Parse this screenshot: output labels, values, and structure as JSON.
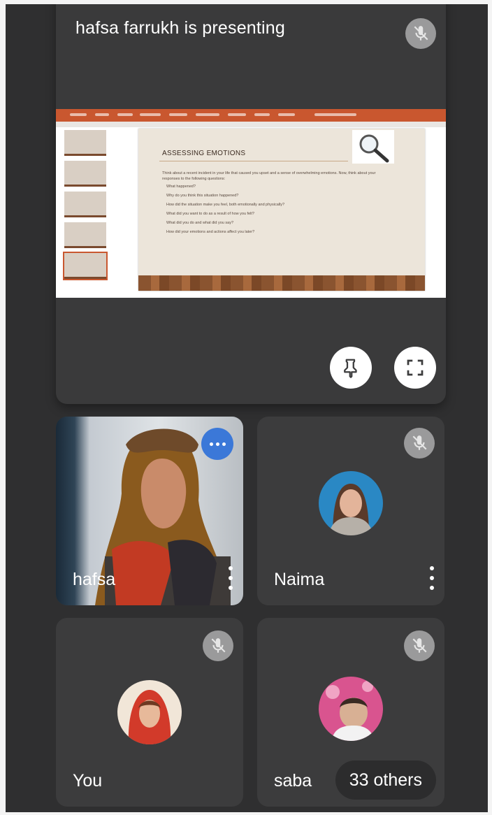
{
  "presenter": {
    "title": "hafsa farrukh is presenting",
    "slide": {
      "heading": "ASSESSING EMOTIONS",
      "intro": "Think about a recent incident in your life that caused you upset and a sense of overwhelming emotions. Now, think about your responses to the following questions:",
      "bullets": [
        "What happened?",
        "Why do you think this situation happened?",
        "How did the situation make you feel, both emotionally and physically?",
        "What did you want to do as a result of how you felt?",
        "What did you do and what did you say?",
        "How did your emotions and actions affect you later?"
      ]
    },
    "pin_icon": "pin-icon",
    "fullscreen_icon": "fullscreen-icon"
  },
  "participants": [
    {
      "name": "hafsa",
      "has_video": true,
      "muted": false
    },
    {
      "name": "Naima",
      "has_video": false,
      "muted": true
    },
    {
      "name": "You",
      "has_video": false,
      "muted": true
    },
    {
      "name": "saba",
      "has_video": false,
      "muted": true
    }
  ],
  "others": {
    "label": "33 others"
  },
  "colors": {
    "background": "#2f2f30",
    "tile": "#3c3c3d",
    "accent_blue": "#3b78d8",
    "ppt_orange": "#c9572f"
  }
}
